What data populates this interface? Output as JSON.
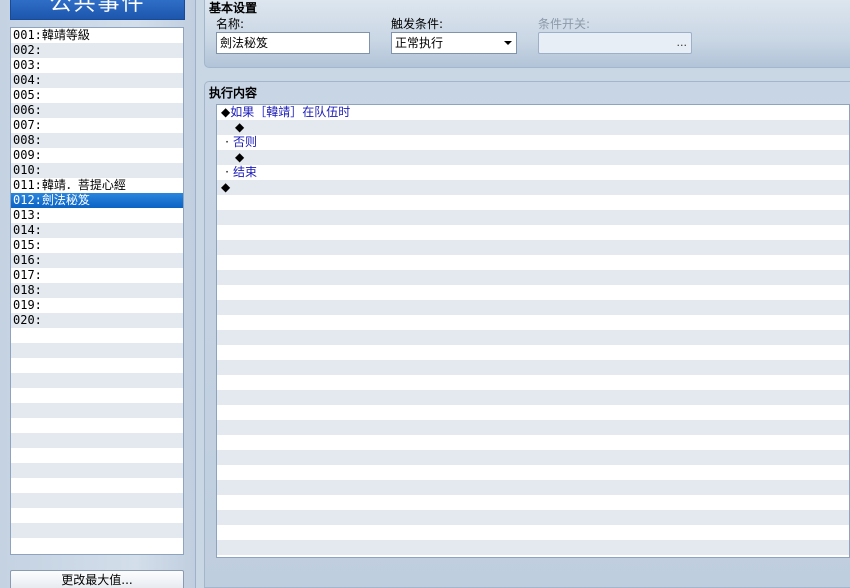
{
  "left": {
    "title": "公共事件",
    "items": [
      {
        "num": "001:",
        "label": "韓靖等級"
      },
      {
        "num": "002:",
        "label": ""
      },
      {
        "num": "003:",
        "label": ""
      },
      {
        "num": "004:",
        "label": ""
      },
      {
        "num": "005:",
        "label": ""
      },
      {
        "num": "006:",
        "label": ""
      },
      {
        "num": "007:",
        "label": ""
      },
      {
        "num": "008:",
        "label": ""
      },
      {
        "num": "009:",
        "label": ""
      },
      {
        "num": "010:",
        "label": ""
      },
      {
        "num": "011:",
        "label": "韓靖．菩提心經"
      },
      {
        "num": "012:",
        "label": "劍法秘笈"
      },
      {
        "num": "013:",
        "label": ""
      },
      {
        "num": "014:",
        "label": ""
      },
      {
        "num": "015:",
        "label": ""
      },
      {
        "num": "016:",
        "label": ""
      },
      {
        "num": "017:",
        "label": ""
      },
      {
        "num": "018:",
        "label": ""
      },
      {
        "num": "019:",
        "label": ""
      },
      {
        "num": "020:",
        "label": ""
      }
    ],
    "selected_index": 11,
    "button_label": "更改最大值..."
  },
  "basic": {
    "title": "基本设置",
    "name_label": "名称:",
    "name_value": "劍法秘笈",
    "trigger_label": "触发条件:",
    "trigger_value": "正常执行",
    "switch_label": "条件开关:",
    "switch_button": "..."
  },
  "exec": {
    "title": "执行内容",
    "rows": [
      {
        "indent": 0,
        "marker": "◆",
        "text": "如果［韓靖］在队伍时"
      },
      {
        "indent": 1,
        "marker": "◆",
        "text": ""
      },
      {
        "indent": 0,
        "marker": "·",
        "text": "否则"
      },
      {
        "indent": 1,
        "marker": "◆",
        "text": ""
      },
      {
        "indent": 0,
        "marker": "·",
        "text": "结束"
      },
      {
        "indent": 0,
        "marker": "◆",
        "text": ""
      }
    ]
  }
}
